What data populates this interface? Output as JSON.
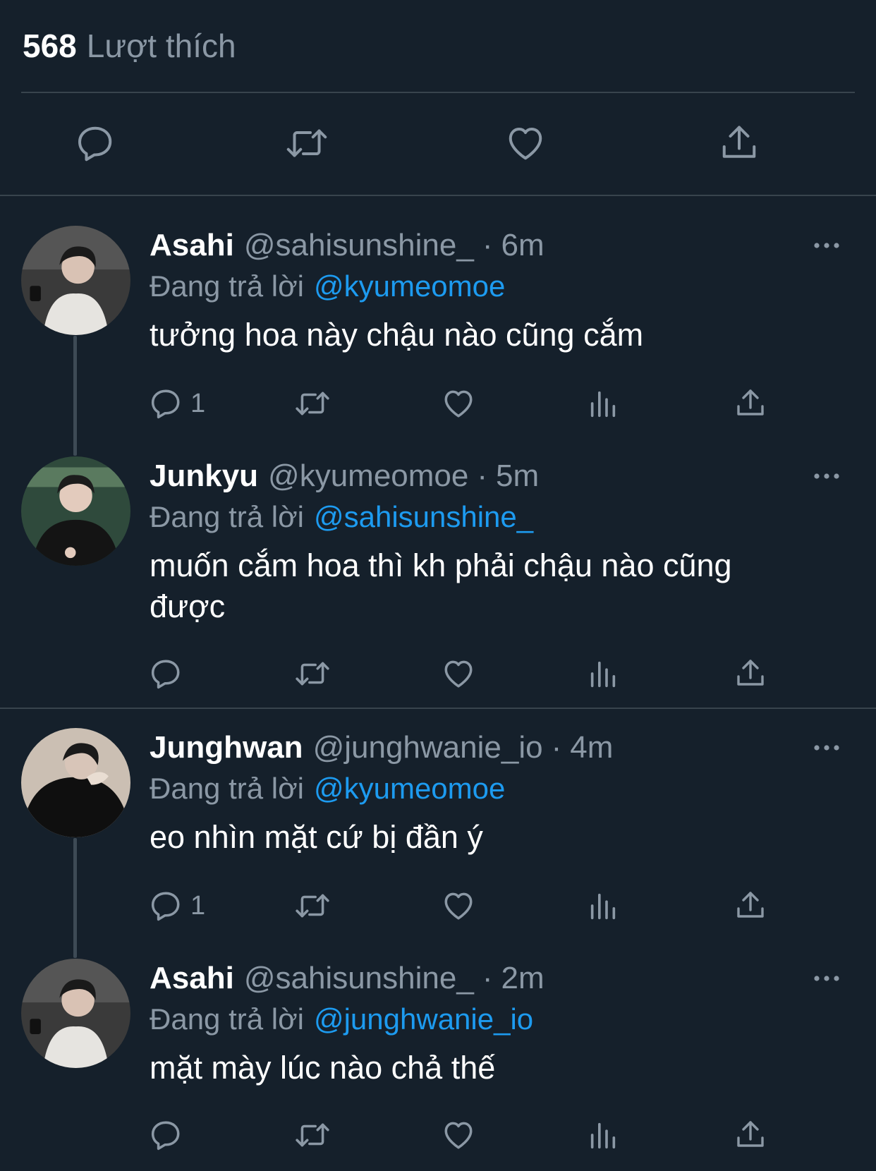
{
  "likes": {
    "count": "568",
    "label": "Lượt thích"
  },
  "replies": [
    {
      "name": "Asahi",
      "handle": "@sahisunshine_",
      "separator": "·",
      "time": "6m",
      "replying_label": "Đang trả lời",
      "replying_to": "@kyumeomoe",
      "text": "tưởng hoa này chậu nào cũng cắm",
      "reply_count": "1",
      "avatar_colors": {
        "bg": "#3a3a3a",
        "shirt": "#e6e4e0",
        "hair": "#1a1a1a",
        "face": "#d9c2b4"
      }
    },
    {
      "name": "Junkyu",
      "handle": "@kyumeomoe",
      "separator": "·",
      "time": "5m",
      "replying_label": "Đang trả lời",
      "replying_to": "@sahisunshine_",
      "text": "muốn cắm hoa thì kh phải chậu nào cũng được",
      "reply_count": "",
      "avatar_colors": {
        "bg": "#2f4a3c",
        "shirt": "#141414",
        "hair": "#1c1c1c",
        "face": "#e3cbbd"
      }
    },
    {
      "name": "Junghwan",
      "handle": "@junghwanie_io",
      "separator": "·",
      "time": "4m",
      "replying_label": "Đang trả lời",
      "replying_to": "@kyumeomoe",
      "text": "eo nhìn mặt cứ bị đần ý",
      "reply_count": "1",
      "avatar_colors": {
        "bg": "#cbbfb3",
        "shirt": "#0f0f0f",
        "hair": "#1a1a1a",
        "face": "#d8c5b8"
      }
    },
    {
      "name": "Asahi",
      "handle": "@sahisunshine_",
      "separator": "·",
      "time": "2m",
      "replying_label": "Đang trả lời",
      "replying_to": "@junghwanie_io",
      "text": "mặt mày lúc nào chả thế",
      "reply_count": "",
      "avatar_colors": {
        "bg": "#3a3a3a",
        "shirt": "#e6e4e0",
        "hair": "#1a1a1a",
        "face": "#d9c2b4"
      }
    }
  ],
  "icons": {
    "main_actions": [
      "reply-icon",
      "retweet-icon",
      "like-icon",
      "share-icon"
    ],
    "reply_actions": [
      "reply-icon",
      "retweet-icon",
      "like-icon",
      "views-icon",
      "share-icon"
    ],
    "more": "more-icon"
  },
  "colors": {
    "background": "#15202b",
    "divider": "#38444d",
    "secondary_text": "#8b98a5",
    "mention": "#1d9bf0",
    "icon": "#8b98a5"
  }
}
